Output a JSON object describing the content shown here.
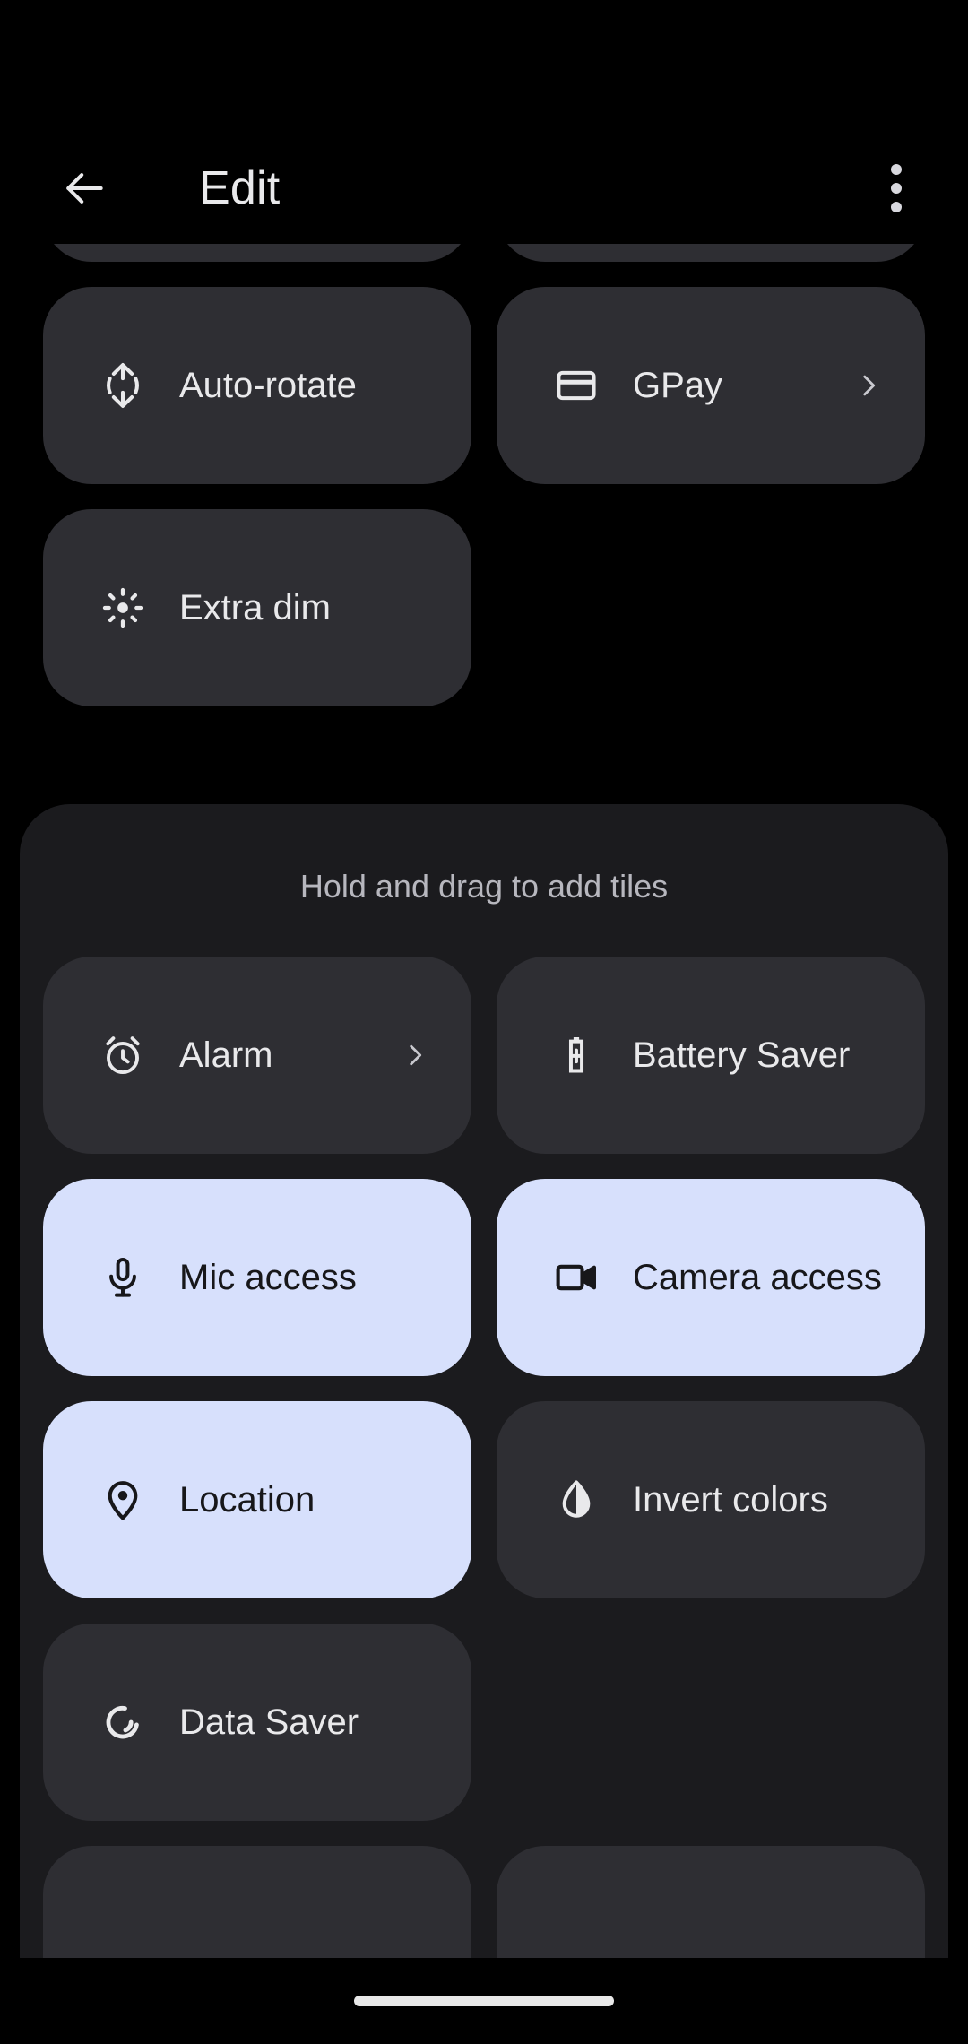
{
  "appbar": {
    "title": "Edit",
    "back_icon": "arrow-back-icon",
    "overflow_icon": "more-vert-icon"
  },
  "current_tiles": {
    "partial_top_count": 2,
    "rows": [
      [
        {
          "label": "Auto-rotate",
          "icon": "auto-rotate-icon",
          "state": "inactive",
          "chevron": false
        },
        {
          "label": "GPay",
          "icon": "credit-card-icon",
          "state": "inactive",
          "chevron": true
        }
      ],
      [
        {
          "label": "Extra dim",
          "icon": "brightness-low-icon",
          "state": "inactive",
          "chevron": false
        }
      ]
    ]
  },
  "add_panel": {
    "header": "Hold and drag to add tiles",
    "rows": [
      [
        {
          "label": "Alarm",
          "icon": "alarm-icon",
          "state": "inactive",
          "chevron": true
        },
        {
          "label": "Battery Saver",
          "icon": "battery-saver-icon",
          "state": "inactive",
          "chevron": false
        }
      ],
      [
        {
          "label": "Mic access",
          "icon": "mic-icon",
          "state": "active",
          "chevron": false
        },
        {
          "label": "Camera access",
          "icon": "videocam-icon",
          "state": "active",
          "chevron": false
        }
      ],
      [
        {
          "label": "Location",
          "icon": "location-pin-icon",
          "state": "active",
          "chevron": false
        },
        {
          "label": "Invert colors",
          "icon": "invert-colors-icon",
          "state": "inactive",
          "chevron": false
        }
      ],
      [
        {
          "label": "Data Saver",
          "icon": "data-saver-icon",
          "state": "inactive",
          "chevron": false
        }
      ]
    ],
    "clipped_bottom_count": 2
  },
  "colors": {
    "background": "#000000",
    "panel": "#1B1B1E",
    "tile_inactive": "#2E2E33",
    "tile_active": "#D7E0FC",
    "text_primary": "#E9E9EB",
    "text_on_active": "#17171A",
    "text_secondary": "#B7B7BE",
    "nav_pill": "#E8E8E8"
  },
  "nav": {
    "gesture_pill": "home-gesture-pill"
  }
}
